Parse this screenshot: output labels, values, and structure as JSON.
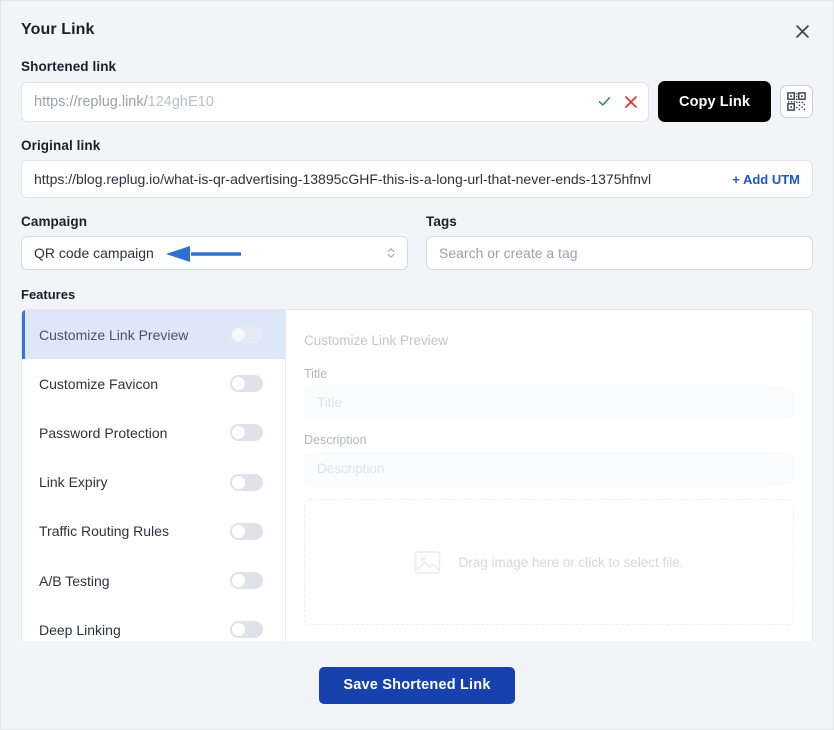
{
  "header": {
    "title": "Your Link",
    "close_icon": "close-icon"
  },
  "shortened_link": {
    "label": "Shortened link",
    "prefix": "https://replug.link/",
    "suffix": "124ghE10",
    "valid_icon": "check-icon",
    "invalid_icon": "x-icon",
    "copy_label": "Copy Link",
    "qr_icon": "qr-code-icon"
  },
  "original_link": {
    "label": "Original link",
    "value": "https://blog.replug.io/what-is-qr-advertising-13895cGHF-this-is-a-long-url-that-never-ends-1375hfnvl",
    "add_utm_label": "+ Add UTM"
  },
  "campaign": {
    "label": "Campaign",
    "value": "QR code campaign",
    "caret_icon": "chevron-up-down-icon"
  },
  "tags": {
    "label": "Tags",
    "placeholder": "Search or create a tag"
  },
  "features": {
    "label": "Features",
    "items": [
      {
        "name": "Customize Link Preview",
        "enabled": false,
        "active": true
      },
      {
        "name": "Customize Favicon",
        "enabled": false,
        "active": false
      },
      {
        "name": "Password Protection",
        "enabled": false,
        "active": false
      },
      {
        "name": "Link Expiry",
        "enabled": false,
        "active": false
      },
      {
        "name": "Traffic Routing Rules",
        "enabled": false,
        "active": false
      },
      {
        "name": "A/B Testing",
        "enabled": false,
        "active": false
      },
      {
        "name": "Deep Linking",
        "enabled": false,
        "active": false
      }
    ]
  },
  "preview_panel": {
    "heading": "Customize Link Preview",
    "title_label": "Title",
    "title_placeholder": "Title",
    "description_label": "Description",
    "description_placeholder": "Description",
    "dropzone_text": "Drag image here or click to select file.",
    "dropzone_icon": "image-icon"
  },
  "footer": {
    "save_label": "Save Shortened Link"
  },
  "annotation": {
    "arrow_icon": "left-arrow-annotation",
    "color": "#2f6fd0"
  },
  "colors": {
    "accent_blue": "#1742ae",
    "link_blue": "#1f55c4",
    "active_row_bg": "#dee6f7",
    "active_border": "#3b74d6",
    "copy_button_bg": "#000000",
    "check_green": "#2e8b47",
    "x_red": "#d9302c"
  }
}
